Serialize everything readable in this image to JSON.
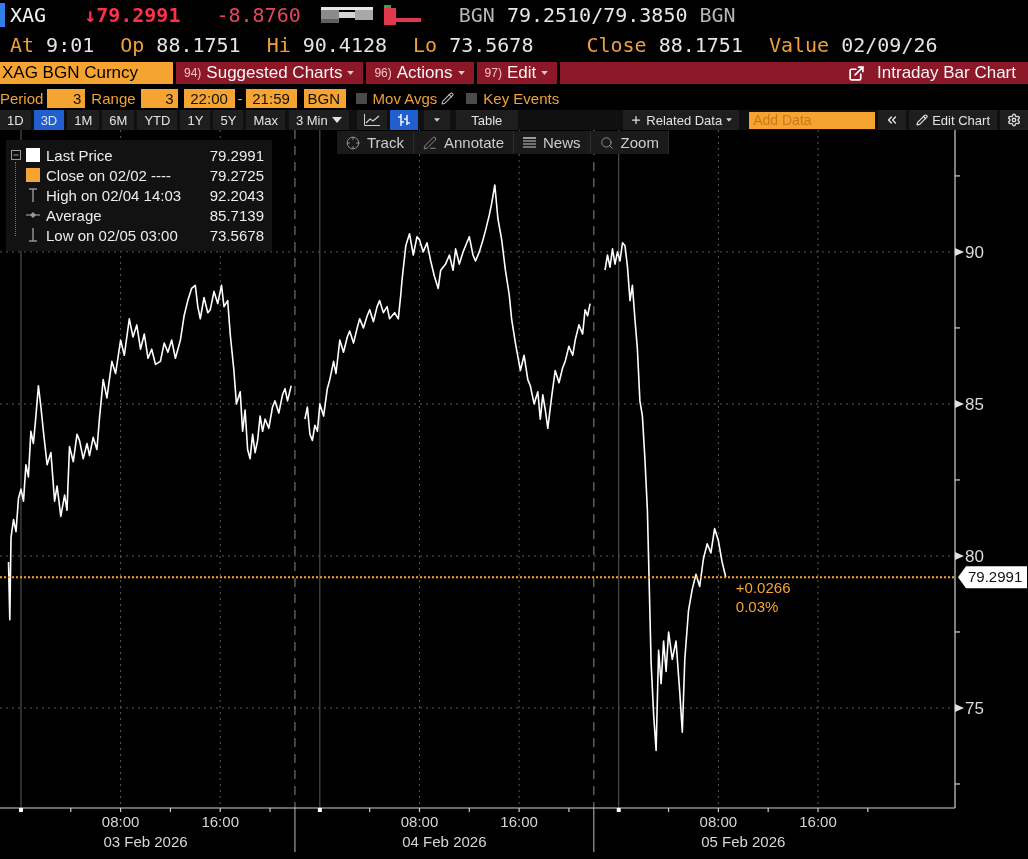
{
  "quote": {
    "ticker": "XAG",
    "last": "↓79.2991",
    "change": "-8.8760",
    "source": "BGN",
    "bid_ask": "79.2510/79.3850",
    "currency": "BGN"
  },
  "stat_groups": [
    {
      "items": [
        {
          "label": "At",
          "value": "9:01"
        },
        {
          "label": "Op",
          "value": "88.1751"
        },
        {
          "label": "Hi",
          "value": "90.4128"
        },
        {
          "label": "Lo",
          "value": "73.5678"
        }
      ]
    },
    {
      "items": [
        {
          "label": "Close",
          "value": "88.1751"
        },
        {
          "label": "Value",
          "value": "02/09/26"
        }
      ]
    }
  ],
  "menu_bar": {
    "security": "XAG BGN Curncy",
    "menus": [
      {
        "number": "94)",
        "label": "Suggested Charts"
      },
      {
        "number": "96)",
        "label": "Actions"
      },
      {
        "number": "97)",
        "label": "Edit"
      }
    ],
    "title": "Intraday Bar Chart"
  },
  "settings": {
    "period_label": "Period",
    "period": "3",
    "range_label": "Range",
    "range": "3",
    "start_time": "22:00",
    "separator": "-",
    "end_time": "21:59",
    "source": "BGN",
    "toggles": [
      {
        "kind": "mov-avgs",
        "label": "Mov Avgs",
        "checked": false
      },
      {
        "kind": "key-events",
        "label": "Key Events",
        "checked": false
      }
    ]
  },
  "toolbar": {
    "ranges": [
      {
        "label": "1D",
        "selected": false
      },
      {
        "label": "3D",
        "selected": true
      },
      {
        "label": "1M",
        "selected": false
      },
      {
        "label": "6M",
        "selected": false
      },
      {
        "label": "YTD",
        "selected": false
      },
      {
        "label": "1Y",
        "selected": false
      },
      {
        "label": "5Y",
        "selected": false
      },
      {
        "label": "Max",
        "selected": false
      }
    ],
    "frequency": "3 Min",
    "chart_types": [
      {
        "kind": "line",
        "selected": false
      },
      {
        "kind": "bar",
        "selected": true
      }
    ],
    "table": "Table",
    "related_data": "Related Data",
    "add_data": {
      "placeholder": "Add Data"
    },
    "edit_chart": "Edit Chart"
  },
  "chart": {
    "tools": [
      {
        "kind": "track",
        "label": "Track"
      },
      {
        "kind": "annotate",
        "label": "Annotate"
      },
      {
        "kind": "news",
        "label": "News"
      },
      {
        "kind": "zoom",
        "label": "Zoom"
      }
    ],
    "legend": [
      {
        "kind": "series",
        "value": "79.2991"
      },
      {
        "kind": "swatch",
        "color": "#f6a431",
        "label": "Close on 02/02 ----",
        "value": "79.2725"
      },
      {
        "kind": "high",
        "label": "High on 02/04 14:03",
        "value": "92.2043"
      },
      {
        "kind": "average",
        "label": "Average",
        "value": "85.7139"
      },
      {
        "kind": "low",
        "label": "Low on 02/05 03:00",
        "value": "73.5678"
      }
    ],
    "date_labels": [
      "03 Feb 2026",
      "04 Feb 2026",
      "05 Feb 2026"
    ],
    "last_price_tag": "79.2991",
    "change_lines": [
      "+0.0266",
      "0.03%"
    ],
    "chart_data": {
      "type": "line",
      "grid": true,
      "xlim": [
        "2026-02-02 22:19",
        "2026-02-06 03:00"
      ],
      "ylim": [
        71.71,
        94.01
      ],
      "yticks": [
        75,
        80,
        85,
        90
      ],
      "xticks": [
        {
          "value": "2026-02-03 08:00",
          "label": "08:00"
        },
        {
          "value": "2026-02-03 16:00",
          "label": "16:00"
        },
        {
          "value": "2026-02-04 08:00",
          "label": "08:00"
        },
        {
          "value": "2026-02-04 16:00",
          "label": "16:00"
        },
        {
          "value": "2026-02-05 08:00",
          "label": "08:00"
        },
        {
          "value": "2026-02-05 16:00",
          "label": "16:00"
        }
      ],
      "x": [
        "2026-02-02 23:00",
        "2026-02-02 23:06",
        "2026-02-02 23:12",
        "2026-02-02 23:24",
        "2026-02-02 23:36",
        "2026-02-02 23:48",
        "2026-02-03 00:00",
        "2026-02-03 00:12",
        "2026-02-03 00:24",
        "2026-02-03 00:36",
        "2026-02-03 00:48",
        "2026-02-03 01:00",
        "2026-02-03 01:12",
        "2026-02-03 01:24",
        "2026-02-03 01:36",
        "2026-02-03 01:48",
        "2026-02-03 02:06",
        "2026-02-03 02:24",
        "2026-02-03 02:42",
        "2026-02-03 02:54",
        "2026-02-03 03:12",
        "2026-02-03 03:30",
        "2026-02-03 03:42",
        "2026-02-03 03:54",
        "2026-02-03 04:12",
        "2026-02-03 04:30",
        "2026-02-03 04:42",
        "2026-02-03 05:00",
        "2026-02-03 05:18",
        "2026-02-03 05:30",
        "2026-02-03 05:48",
        "2026-02-03 06:06",
        "2026-02-03 06:18",
        "2026-02-03 06:36",
        "2026-02-03 06:54",
        "2026-02-03 07:18",
        "2026-02-03 07:36",
        "2026-02-03 08:00",
        "2026-02-03 08:18",
        "2026-02-03 08:42",
        "2026-02-03 09:00",
        "2026-02-03 09:18",
        "2026-02-03 09:36",
        "2026-02-03 09:54",
        "2026-02-03 10:12",
        "2026-02-03 10:30",
        "2026-02-03 10:48",
        "2026-02-03 11:12",
        "2026-02-03 11:30",
        "2026-02-03 11:48",
        "2026-02-03 12:06",
        "2026-02-03 12:24",
        "2026-02-03 12:48",
        "2026-02-03 13:06",
        "2026-02-03 13:24",
        "2026-02-03 13:42",
        "2026-02-03 14:00",
        "2026-02-03 14:12",
        "2026-02-03 14:24",
        "2026-02-03 14:42",
        "2026-02-03 15:00",
        "2026-02-03 15:12",
        "2026-02-03 15:30",
        "2026-02-03 15:48",
        "2026-02-03 16:06",
        "2026-02-03 16:18",
        "2026-02-03 16:36",
        "2026-02-03 16:48",
        "2026-02-03 17:06",
        "2026-02-03 17:18",
        "2026-02-03 17:36",
        "2026-02-03 17:48",
        "2026-02-03 18:00",
        "2026-02-03 18:12",
        "2026-02-03 18:24",
        "2026-02-03 18:36",
        "2026-02-03 18:48",
        "2026-02-03 19:00",
        "2026-02-03 19:12",
        "2026-02-03 19:24",
        "2026-02-03 19:36",
        "2026-02-03 19:54",
        "2026-02-03 20:12",
        "2026-02-03 20:24",
        "2026-02-03 20:42",
        "2026-02-03 21:00",
        "2026-02-03 21:12",
        "2026-02-03 21:24",
        "2026-02-03 21:42",
        "2026-02-03 22:00",
        "2026-02-03 22:48",
        "2026-02-03 23:00",
        "2026-02-03 23:12",
        "2026-02-03 23:24",
        "2026-02-03 23:36",
        "2026-02-03 23:48",
        "2026-02-04 00:00",
        "2026-02-04 00:18",
        "2026-02-04 00:36",
        "2026-02-04 00:48",
        "2026-02-04 01:06",
        "2026-02-04 01:18",
        "2026-02-04 01:36",
        "2026-02-04 01:54",
        "2026-02-04 02:12",
        "2026-02-04 02:24",
        "2026-02-04 02:42",
        "2026-02-04 03:00",
        "2026-02-04 03:12",
        "2026-02-04 03:30",
        "2026-02-04 03:48",
        "2026-02-04 04:00",
        "2026-02-04 04:18",
        "2026-02-04 04:36",
        "2026-02-04 04:48",
        "2026-02-04 05:06",
        "2026-02-04 05:24",
        "2026-02-04 05:36",
        "2026-02-04 06:00",
        "2026-02-04 06:18",
        "2026-02-04 06:30",
        "2026-02-04 06:36",
        "2026-02-04 06:54",
        "2026-02-04 07:12",
        "2026-02-04 07:30",
        "2026-02-04 07:48",
        "2026-02-04 08:00",
        "2026-02-04 08:18",
        "2026-02-04 08:36",
        "2026-02-04 08:54",
        "2026-02-04 09:12",
        "2026-02-04 09:30",
        "2026-02-04 09:42",
        "2026-02-04 10:06",
        "2026-02-04 10:24",
        "2026-02-04 10:42",
        "2026-02-04 10:54",
        "2026-02-04 11:12",
        "2026-02-04 11:30",
        "2026-02-04 11:42",
        "2026-02-04 12:00",
        "2026-02-04 12:18",
        "2026-02-04 12:30",
        "2026-02-04 12:48",
        "2026-02-04 13:06",
        "2026-02-04 13:18",
        "2026-02-04 13:36",
        "2026-02-04 13:48",
        "2026-02-04 14:03",
        "2026-02-04 14:18",
        "2026-02-04 14:36",
        "2026-02-04 14:54",
        "2026-02-04 15:12",
        "2026-02-04 15:24",
        "2026-02-04 15:42",
        "2026-02-04 16:06",
        "2026-02-04 16:24",
        "2026-02-04 16:42",
        "2026-02-04 16:54",
        "2026-02-04 17:12",
        "2026-02-04 17:30",
        "2026-02-04 17:42",
        "2026-02-04 17:54",
        "2026-02-04 18:06",
        "2026-02-04 18:18",
        "2026-02-04 18:36",
        "2026-02-04 18:54",
        "2026-02-04 19:12",
        "2026-02-04 19:30",
        "2026-02-04 19:42",
        "2026-02-04 20:00",
        "2026-02-04 20:18",
        "2026-02-04 20:30",
        "2026-02-04 20:48",
        "2026-02-04 21:06",
        "2026-02-04 21:18",
        "2026-02-04 21:30",
        "2026-02-04 21:42",
        "2026-02-04 22:00",
        "2026-02-04 22:54",
        "2026-02-04 23:06",
        "2026-02-04 23:18",
        "2026-02-04 23:30",
        "2026-02-04 23:42",
        "2026-02-04 23:54",
        "2026-02-05 00:06",
        "2026-02-05 00:18",
        "2026-02-05 00:30",
        "2026-02-05 00:42",
        "2026-02-05 00:54",
        "2026-02-05 01:06",
        "2026-02-05 01:18",
        "2026-02-05 01:30",
        "2026-02-05 01:42",
        "2026-02-05 01:54",
        "2026-02-05 02:06",
        "2026-02-05 02:18",
        "2026-02-05 02:24",
        "2026-02-05 02:36",
        "2026-02-05 02:48",
        "2026-02-05 03:00",
        "2026-02-05 03:12",
        "2026-02-05 03:24",
        "2026-02-05 03:36",
        "2026-02-05 03:48",
        "2026-02-05 04:00",
        "2026-02-05 04:18",
        "2026-02-05 04:36",
        "2026-02-05 04:54",
        "2026-02-05 05:06",
        "2026-02-05 05:18",
        "2026-02-05 05:36",
        "2026-02-05 05:54",
        "2026-02-05 06:12",
        "2026-02-05 06:30",
        "2026-02-05 06:48",
        "2026-02-05 07:06",
        "2026-02-05 07:24",
        "2026-02-05 07:42",
        "2026-02-05 08:00",
        "2026-02-05 08:18",
        "2026-02-05 08:36"
      ],
      "series": [
        {
          "name": "Last Price",
          "color": "#ffffff",
          "values": [
            79.8,
            77.9,
            80.6,
            81.2,
            80.8,
            81.9,
            82.2,
            81.8,
            83.0,
            82.6,
            84.1,
            83.7,
            84.6,
            85.6,
            84.9,
            84.1,
            83.0,
            83.4,
            81.8,
            82.3,
            81.3,
            82.0,
            81.5,
            83.6,
            83.1,
            84.0,
            83.8,
            83.2,
            83.7,
            83.3,
            83.9,
            83.5,
            84.5,
            85.8,
            85.2,
            86.4,
            86.0,
            87.1,
            86.6,
            87.8,
            87.2,
            87.6,
            86.8,
            87.3,
            86.5,
            86.8,
            86.3,
            86.4,
            87.0,
            86.7,
            87.1,
            86.5,
            87.1,
            87.9,
            88.4,
            88.8,
            88.9,
            88.2,
            87.8,
            88.5,
            88.0,
            88.1,
            88.7,
            88.3,
            88.9,
            88.2,
            88.4,
            87.3,
            86.1,
            85.0,
            85.4,
            84.1,
            84.8,
            83.5,
            83.2,
            84.0,
            83.4,
            83.8,
            84.6,
            84.1,
            84.5,
            84.2,
            84.9,
            85.1,
            84.7,
            85.3,
            85.5,
            85.1,
            85.6,
            null,
            84.5,
            84.9,
            84.0,
            83.8,
            84.3,
            84.1,
            85.0,
            84.6,
            85.5,
            85.8,
            86.4,
            86.0,
            87.1,
            86.7,
            87.2,
            87.4,
            87.0,
            87.5,
            87.8,
            87.5,
            87.9,
            88.1,
            87.7,
            88.2,
            88.4,
            88.0,
            88.2,
            87.8,
            88.0,
            87.8,
            88.6,
            89.1,
            90.2,
            90.6,
            89.9,
            90.5,
            90.4,
            90.0,
            90.3,
            89.7,
            89.2,
            88.8,
            89.4,
            89.6,
            89.9,
            89.4,
            90.1,
            89.6,
            90.0,
            90.2,
            90.5,
            89.9,
            89.7,
            90.0,
            90.4,
            90.7,
            91.2,
            91.6,
            92.2,
            91.1,
            90.4,
            89.4,
            88.6,
            87.8,
            87.0,
            86.1,
            86.6,
            85.8,
            85.6,
            85.0,
            85.4,
            84.5,
            85.3,
            84.8,
            84.2,
            85.2,
            86.1,
            85.7,
            86.2,
            86.4,
            86.9,
            86.6,
            87.1,
            87.6,
            87.3,
            88.1,
            87.9,
            88.3,
            null,
            89.4,
            89.9,
            89.5,
            90.1,
            89.6,
            90.0,
            89.7,
            90.3,
            90.2,
            89.5,
            88.4,
            88.9,
            87.8,
            86.8,
            85.1,
            84.6,
            83.2,
            81.5,
            79.9,
            76.5,
            74.8,
            73.6,
            76.9,
            75.8,
            77.2,
            76.2,
            77.5,
            76.6,
            77.2,
            75.5,
            74.2,
            76.6,
            78.2,
            78.9,
            79.4,
            79.0,
            79.9,
            80.4,
            80.1,
            80.9,
            80.5,
            79.8,
            79.3
          ]
        }
      ],
      "ref_lines": [
        {
          "axis": "x",
          "value": "2026-02-03 22:00",
          "color": "#8a8a8a"
        },
        {
          "axis": "x",
          "value": "2026-02-04 22:00",
          "color": "#8a8a8a"
        },
        {
          "axis": "y",
          "value": 79.3,
          "color": "#f6a431"
        }
      ]
    }
  }
}
